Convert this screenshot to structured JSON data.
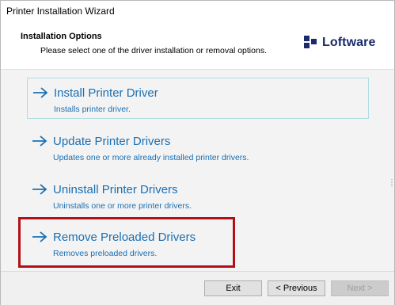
{
  "window": {
    "title": "Printer Installation Wizard"
  },
  "header": {
    "title": "Installation Options",
    "subtitle": "Please select one of the driver installation or removal options.",
    "logo_text": "Loftware",
    "logo_color": "#1a2b6b"
  },
  "options": [
    {
      "title": "Install Printer Driver",
      "description": "Installs printer driver.",
      "icon": "arrow-right-icon",
      "hovered": true
    },
    {
      "title": "Update Printer Drivers",
      "description": "Updates one or more already installed printer drivers.",
      "icon": "arrow-right-icon",
      "hovered": false
    },
    {
      "title": "Uninstall Printer Drivers",
      "description": "Uninstalls one or more printer drivers.",
      "icon": "arrow-right-icon",
      "hovered": false
    },
    {
      "title": "Remove Preloaded Drivers",
      "description": "Removes preloaded drivers.",
      "icon": "arrow-right-icon",
      "hovered": false,
      "highlighted": true
    }
  ],
  "footer": {
    "exit_label": "Exit",
    "previous_label": "< Previous",
    "next_label": "Next >",
    "next_disabled": true
  },
  "colors": {
    "link_blue": "#1a6fb3",
    "highlight_red": "#b01016",
    "hover_border": "#aedbe4"
  }
}
